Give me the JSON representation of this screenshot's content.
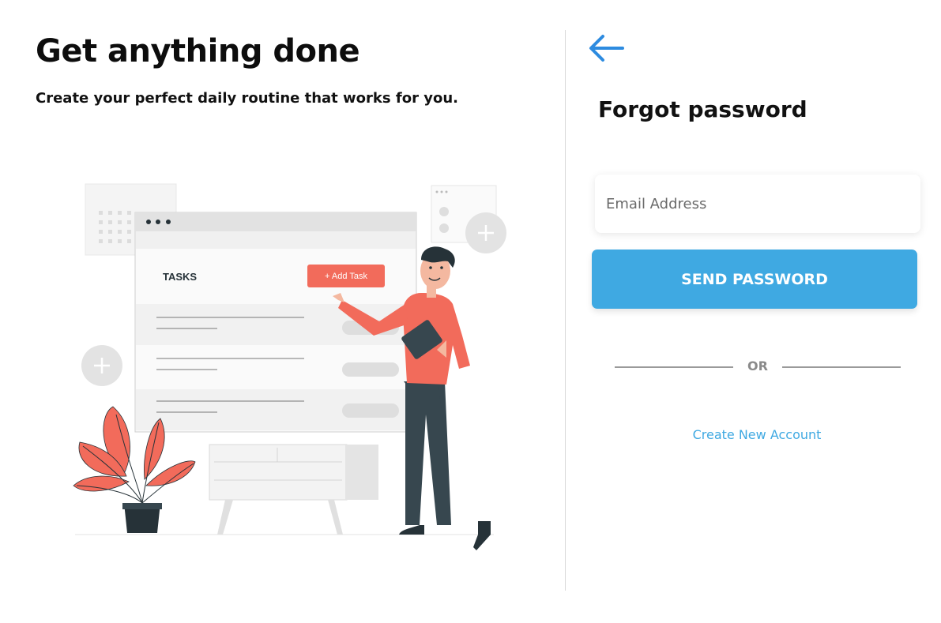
{
  "hero": {
    "title": "Get anything done",
    "subtitle": "Create your perfect daily routine that works for you."
  },
  "illustration": {
    "tasks_label": "TASKS",
    "add_task_label": "+ Add Task",
    "accent_color": "#f26b5b"
  },
  "form": {
    "back_icon": "arrow-left-icon",
    "title": "Forgot password",
    "email_placeholder": "Email Address",
    "email_value": "",
    "send_label": "SEND PASSWORD",
    "or_label": "OR",
    "create_account_label": "Create New Account"
  },
  "colors": {
    "primary": "#3fa9e2",
    "back_arrow": "#2d8be0",
    "divider": "#d9d9d9"
  }
}
